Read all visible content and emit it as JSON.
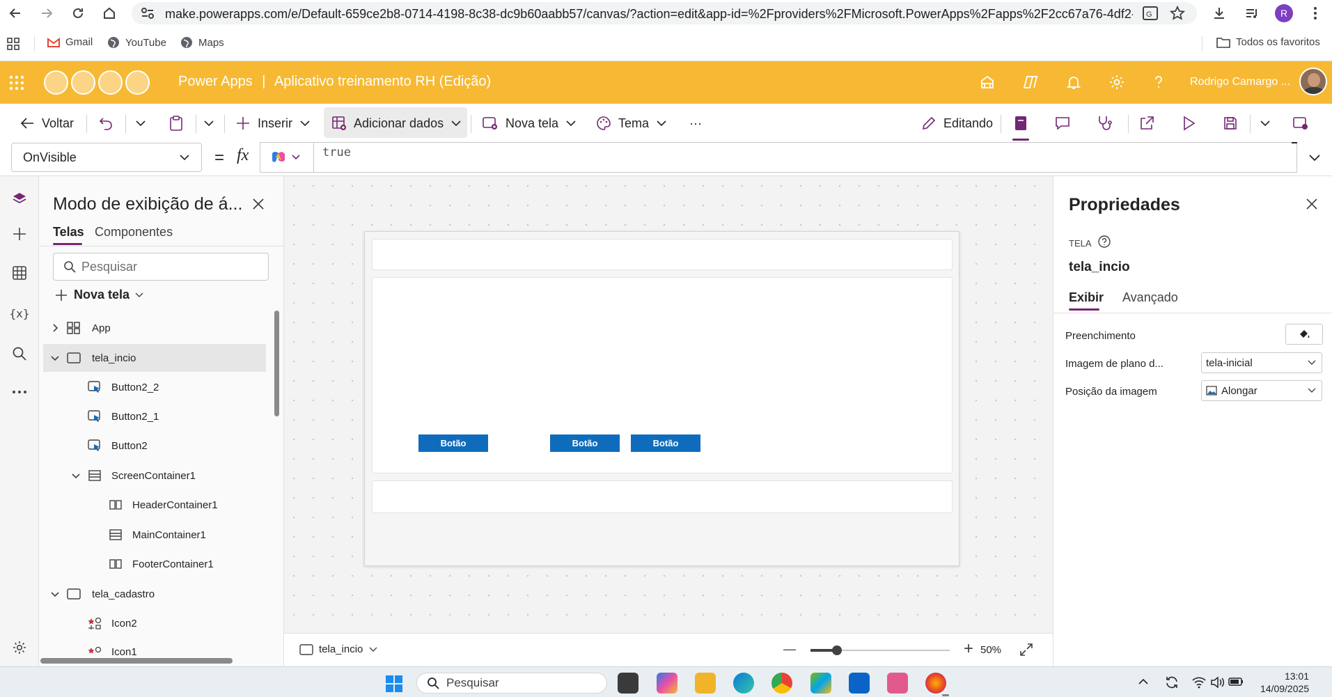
{
  "browser": {
    "url": "make.powerapps.com/e/Default-659ce2b8-0714-4198-8c38-dc9b60aabb57/canvas/?action=edit&app-id=%2Fproviders%2FMicrosoft.PowerApps%2Fapps%2F2cc67a76-4df2-41a...",
    "profile_initial": "R",
    "bookmarks": [
      "Gmail",
      "YouTube",
      "Maps"
    ],
    "all_bookmarks_label": "Todos os favoritos"
  },
  "header": {
    "product": "Power Apps",
    "separator": "|",
    "app_name": "Aplicativo treinamento RH (Edição)",
    "user_name": "Rodrigo Camargo ..."
  },
  "toolbar": {
    "back_label": "Voltar",
    "insert_label": "Inserir",
    "add_data_label": "Adicionar dados",
    "new_screen_label": "Nova tela",
    "theme_label": "Tema",
    "more_label": "···",
    "editing_label": "Editando"
  },
  "formula": {
    "property": "OnVisible",
    "equals": "=",
    "fx": "fx",
    "value": "true"
  },
  "tree": {
    "title": "Modo de exibição de á...",
    "tabs": [
      "Telas",
      "Componentes"
    ],
    "search_placeholder": "Pesquisar",
    "new_screen_label": "Nova tela",
    "items": [
      {
        "label": "App",
        "icon": "app-icon"
      },
      {
        "label": "tela_incio",
        "icon": "screen-icon"
      },
      {
        "label": "Button2_2",
        "icon": "button-control-icon"
      },
      {
        "label": "Button2_1",
        "icon": "button-control-icon"
      },
      {
        "label": "Button2",
        "icon": "button-control-icon"
      },
      {
        "label": "ScreenContainer1",
        "icon": "vertical-container-icon"
      },
      {
        "label": "HeaderContainer1",
        "icon": "horizontal-container-icon"
      },
      {
        "label": "MainContainer1",
        "icon": "vertical-container-icon"
      },
      {
        "label": "FooterContainer1",
        "icon": "horizontal-container-icon"
      },
      {
        "label": "tela_cadastro",
        "icon": "screen-icon"
      },
      {
        "label": "Icon2",
        "icon": "icon-control-icon"
      },
      {
        "label": "Icon1",
        "icon": "icon-control-icon"
      }
    ]
  },
  "canvas": {
    "button_text": "Botão",
    "screen_selector": "tela_incio",
    "zoom_minus": "—",
    "zoom_plus": "+",
    "zoom": "50%",
    "zoom_level": 0.5
  },
  "properties": {
    "title": "Propriedades",
    "type_label": "TELA",
    "screen_name": "tela_incio",
    "tabs": [
      "Exibir",
      "Avançado"
    ],
    "fill_label": "Preenchimento",
    "bg_image_label": "Imagem de plano d...",
    "bg_image_value": "tela-inicial",
    "image_position_label": "Posição da imagem",
    "image_position_value": "Alongar"
  },
  "taskbar": {
    "search_placeholder": "Pesquisar",
    "time": "13:01",
    "date": "14/09/2025"
  },
  "colors": {
    "header": "#f7b933",
    "accent": "#742774",
    "control_button": "#0f6cbd"
  }
}
